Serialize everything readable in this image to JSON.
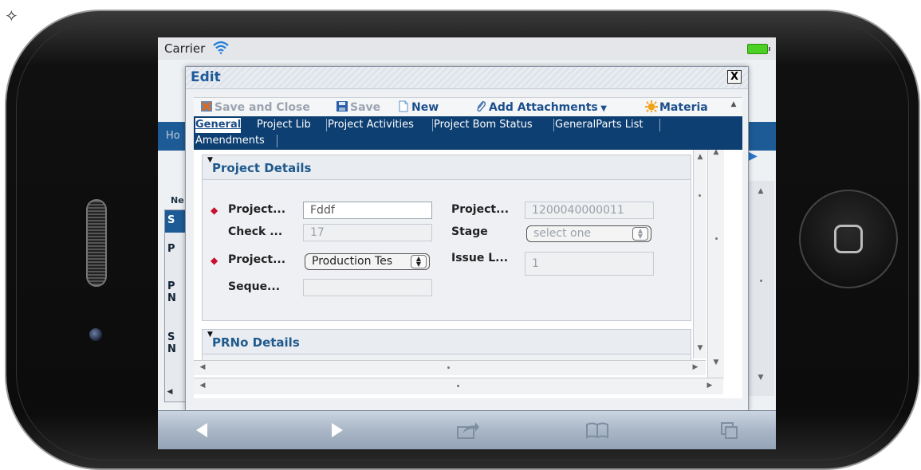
{
  "status_bar": {
    "carrier": "Carrier"
  },
  "background_app": {
    "tab_home": "Ho",
    "label_ne": "Ne",
    "letters": [
      "S",
      "P",
      "P",
      "N",
      "S",
      "N"
    ],
    "s_icon": "S"
  },
  "dialog": {
    "title": "Edit",
    "close_label": "X",
    "toolbar": {
      "save_close": "Save and Close",
      "save": "Save",
      "new": "New",
      "add_attachments": "Add Attachments",
      "materials": "Materia"
    },
    "tabs": [
      "General",
      "Project Lib",
      "Project Activities",
      "Project Bom Status",
      "GeneralParts List",
      "Amendments"
    ],
    "sections": {
      "project_details": {
        "title": "Project Details",
        "fields": {
          "project1_label": "Project...",
          "project1_value": "Fddf",
          "check_label": "Check ...",
          "check_value": "17",
          "project2_label": "Project...",
          "project2_value": "Production Tes",
          "sequence_label": "Seque...",
          "sequence_value": "",
          "project3_label": "Project...",
          "project3_value": "1200040000011",
          "stage_label": "Stage",
          "stage_value": "select one",
          "issue_label": "Issue L...",
          "issue_value": "1"
        }
      },
      "prno_details": {
        "title": "PRNo Details"
      }
    }
  },
  "colors": {
    "accent": "#1f5a9a",
    "tab_bar": "#0d3f72",
    "required": "#c8102e"
  },
  "icons": [
    "wifi-icon",
    "battery-icon",
    "save-close-icon",
    "save-icon",
    "new-icon",
    "attachment-icon",
    "materials-icon",
    "back-icon",
    "forward-icon",
    "share-icon",
    "bookmarks-icon",
    "pages-icon"
  ]
}
